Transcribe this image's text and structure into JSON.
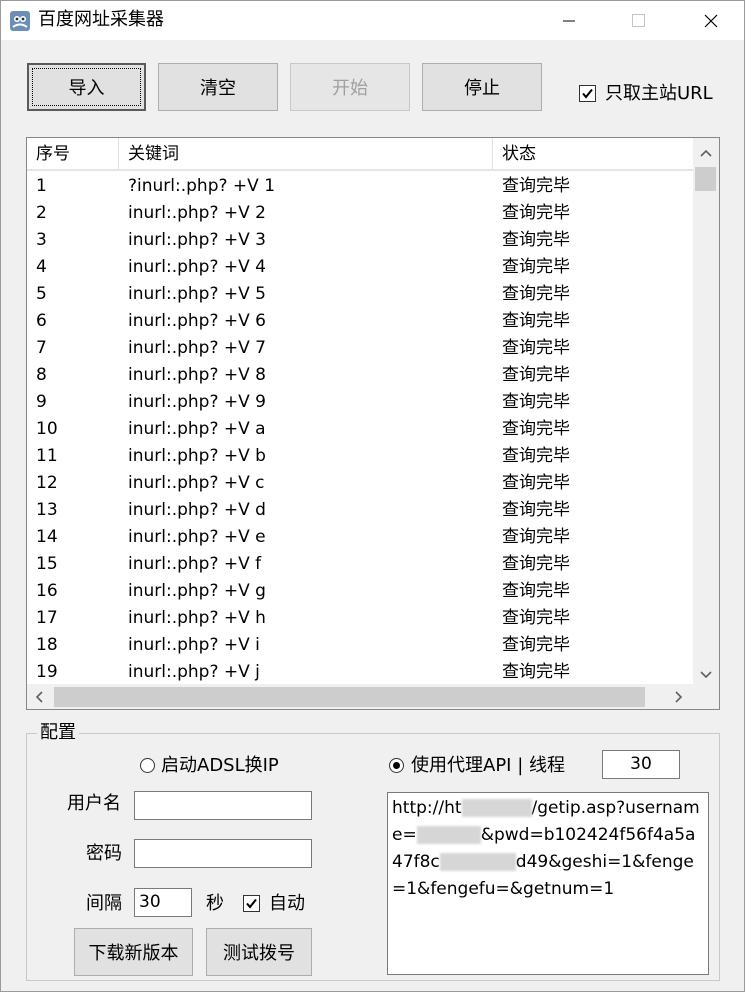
{
  "window": {
    "title": "百度网址采集器",
    "minimize_label": "—",
    "maximize_label": "☐",
    "close_label": "✕"
  },
  "toolbar": {
    "import_label": "导入",
    "clear_label": "清空",
    "start_label": "开始",
    "stop_label": "停止",
    "only_main_url_label": "只取主站URL",
    "only_main_url_checked": true
  },
  "list": {
    "columns": [
      "序号",
      "关键词",
      "状态"
    ],
    "rows": [
      [
        "1",
        "?inurl:.php? +V 1",
        "查询完毕"
      ],
      [
        "2",
        "inurl:.php? +V 2",
        "查询完毕"
      ],
      [
        "3",
        "inurl:.php? +V 3",
        "查询完毕"
      ],
      [
        "4",
        "inurl:.php? +V 4",
        "查询完毕"
      ],
      [
        "5",
        "inurl:.php? +V 5",
        "查询完毕"
      ],
      [
        "6",
        "inurl:.php? +V 6",
        "查询完毕"
      ],
      [
        "7",
        "inurl:.php? +V 7",
        "查询完毕"
      ],
      [
        "8",
        "inurl:.php? +V 8",
        "查询完毕"
      ],
      [
        "9",
        "inurl:.php? +V 9",
        "查询完毕"
      ],
      [
        "10",
        "inurl:.php? +V a",
        "查询完毕"
      ],
      [
        "11",
        "inurl:.php? +V b",
        "查询完毕"
      ],
      [
        "12",
        "inurl:.php? +V c",
        "查询完毕"
      ],
      [
        "13",
        "inurl:.php? +V d",
        "查询完毕"
      ],
      [
        "14",
        "inurl:.php? +V e",
        "查询完毕"
      ],
      [
        "15",
        "inurl:.php? +V f",
        "查询完毕"
      ],
      [
        "16",
        "inurl:.php? +V g",
        "查询完毕"
      ],
      [
        "17",
        "inurl:.php? +V h",
        "查询完毕"
      ],
      [
        "18",
        "inurl:.php? +V i",
        "查询完毕"
      ],
      [
        "19",
        "inurl:.php? +V j",
        "查询完毕"
      ]
    ]
  },
  "config": {
    "group_title": "配置",
    "adsl_label": "启动ADSL换IP",
    "proxy_label": "使用代理API | 线程",
    "threads_value": "30",
    "username_label": "用户名",
    "username_value": "",
    "password_label": "密码",
    "password_value": "",
    "interval_label": "间隔",
    "interval_value": "30",
    "seconds_label": "秒",
    "auto_label": "自动",
    "auto_checked": true,
    "download_label": "下载新版本",
    "test_dial_label": "测试拨号",
    "api_url_part1": "http://ht",
    "api_url_part2": "/getip.asp?username=",
    "api_url_part3": "&pwd=b102424f56f4a5a47f8c",
    "api_url_part4": "d49&geshi=1&fenge=1&fengefu=&getnum=1"
  }
}
